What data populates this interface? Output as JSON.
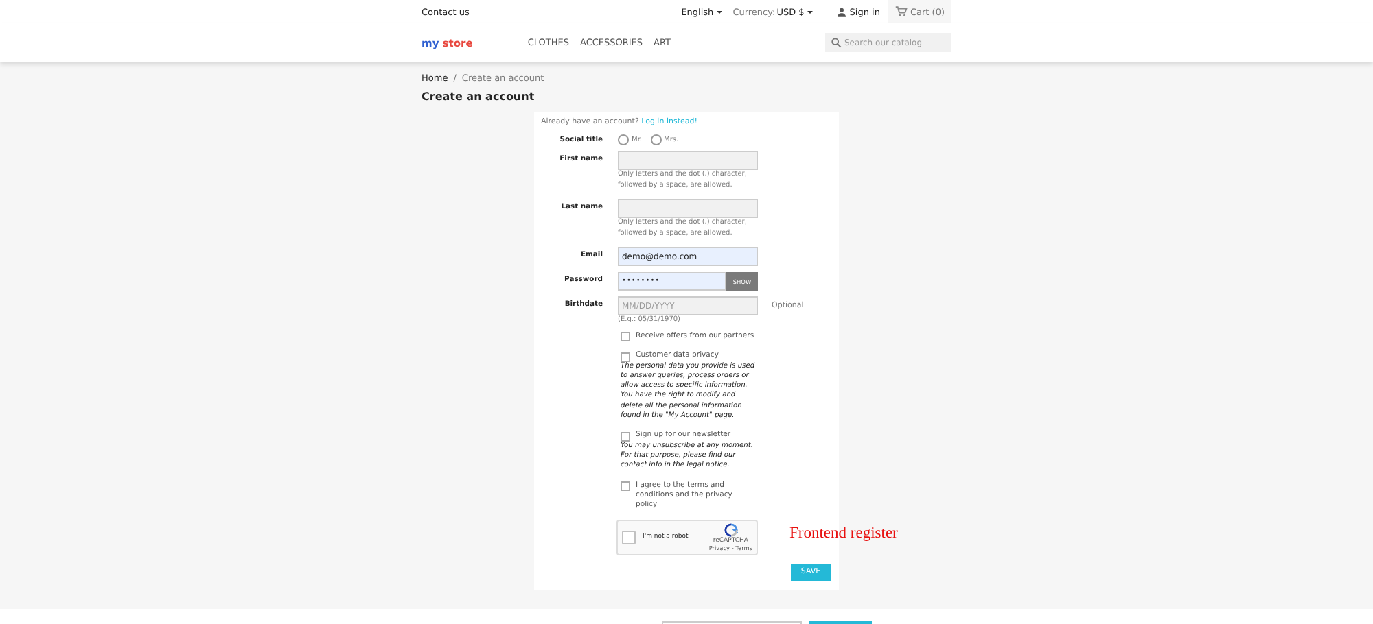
{
  "topbar": {
    "contact": "Contact us",
    "language": "English",
    "currency_label": "Currency:",
    "currency": "USD $",
    "sign_in": "Sign in",
    "cart": "Cart (0)"
  },
  "header": {
    "logo": [
      {
        "text": "my",
        "color": "#2f5fd0"
      },
      {
        "text": "store",
        "color": "#e8483f"
      }
    ],
    "menu": [
      "CLOTHES",
      "ACCESSORIES",
      "ART"
    ],
    "search": {
      "placeholder": "Search our catalog"
    }
  },
  "breadcrumb": {
    "items": [
      "Home",
      "Create an account"
    ],
    "separator": "/"
  },
  "title": "Create an account",
  "form": {
    "login_prompt": "Already have an account?",
    "login_link": "Log in instead!",
    "fields": [
      {
        "kind": "radio",
        "label": "Social title",
        "options": [
          {
            "label": "Mr.",
            "selected": false
          },
          {
            "label": "Mrs.",
            "selected": false
          }
        ]
      },
      {
        "kind": "text",
        "label": "First name",
        "hint": "Only letters and the dot (.) character, followed by a space, are allowed."
      },
      {
        "kind": "text",
        "label": "Last name",
        "hint": "Only letters and the dot (.) character, followed by a space, are allowed."
      },
      {
        "kind": "text",
        "label": "Email",
        "value": "demo@demo.com",
        "autofilled": true
      },
      {
        "kind": "password",
        "label": "Password",
        "value": "••••••••",
        "button": "SHOW",
        "autofilled": true
      },
      {
        "kind": "text",
        "label": "Birthdate",
        "placeholder": "MM/DD/YYYY",
        "hint": "(E.g.: 05/31/1970)",
        "aside": "Optional"
      }
    ],
    "checkboxes": [
      {
        "label": "Receive offers from our partners",
        "checked": false
      },
      {
        "label": "Customer data privacy",
        "checked": false,
        "note": "The personal data you provide is used to answer queries, process orders or allow access to specific information. You have the right to modify and delete all the personal information found in the \"My Account\" page."
      },
      {
        "label": "Sign up for our newsletter",
        "checked": false,
        "note": "You may unsubscribe at any moment. For that purpose, please find our contact info in the legal notice."
      },
      {
        "label": "I agree to the terms and conditions and the privacy policy",
        "checked": false
      }
    ],
    "captcha": {
      "label": "I'm not a robot",
      "brand": "reCAPTCHA",
      "links": "Privacy - Terms",
      "checked": false
    },
    "submit": "SAVE"
  },
  "annotation": "Frontend register"
}
